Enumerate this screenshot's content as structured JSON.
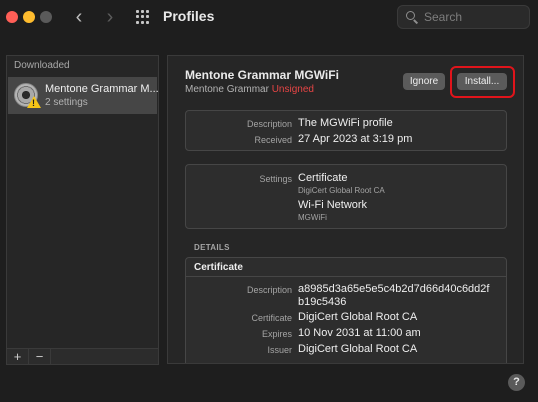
{
  "window": {
    "title": "Profiles",
    "search_placeholder": "Search"
  },
  "nav": {
    "back_glyph": "‹",
    "forward_glyph": "›"
  },
  "sidebar": {
    "section_title": "Downloaded",
    "items": [
      {
        "name": "Mentone Grammar M...",
        "subtitle": "2 settings",
        "icon": "settings-gear-icon",
        "badge": "warning-icon"
      }
    ],
    "add_label": "+",
    "remove_label": "−"
  },
  "profile": {
    "name": "Mentone Grammar MGWiFi",
    "organization": "Mentone Grammar",
    "signature_status": "Unsigned",
    "ignore_label": "Ignore",
    "install_label": "Install..."
  },
  "summary": {
    "description_label": "Description",
    "description_value": "The MGWiFi profile",
    "received_label": "Received",
    "received_value": "27 Apr 2023 at 3:19 pm"
  },
  "settings": {
    "label": "Settings",
    "entries": [
      {
        "title": "Certificate",
        "detail": "DigiCert Global Root CA"
      },
      {
        "title": "Wi-Fi Network",
        "detail": "MGWiFi"
      }
    ]
  },
  "details": {
    "heading": "DETAILS",
    "section_title": "Certificate",
    "description_label": "Description",
    "description_line1": "a8985d3a65e5e5c4b2d7d66d40c6dd2f",
    "description_line2": "b19c5436",
    "certificate_label": "Certificate",
    "certificate_value": "DigiCert Global Root CA",
    "expires_label": "Expires",
    "expires_value": "10 Nov 2031 at 11:00 am",
    "issuer_label": "Issuer",
    "issuer_value": "DigiCert Global Root CA"
  },
  "help_label": "?",
  "colors": {
    "unsigned": "#e64545",
    "highlight": "#e0141b",
    "close": "#ff5f57",
    "minimize": "#febc2e"
  }
}
